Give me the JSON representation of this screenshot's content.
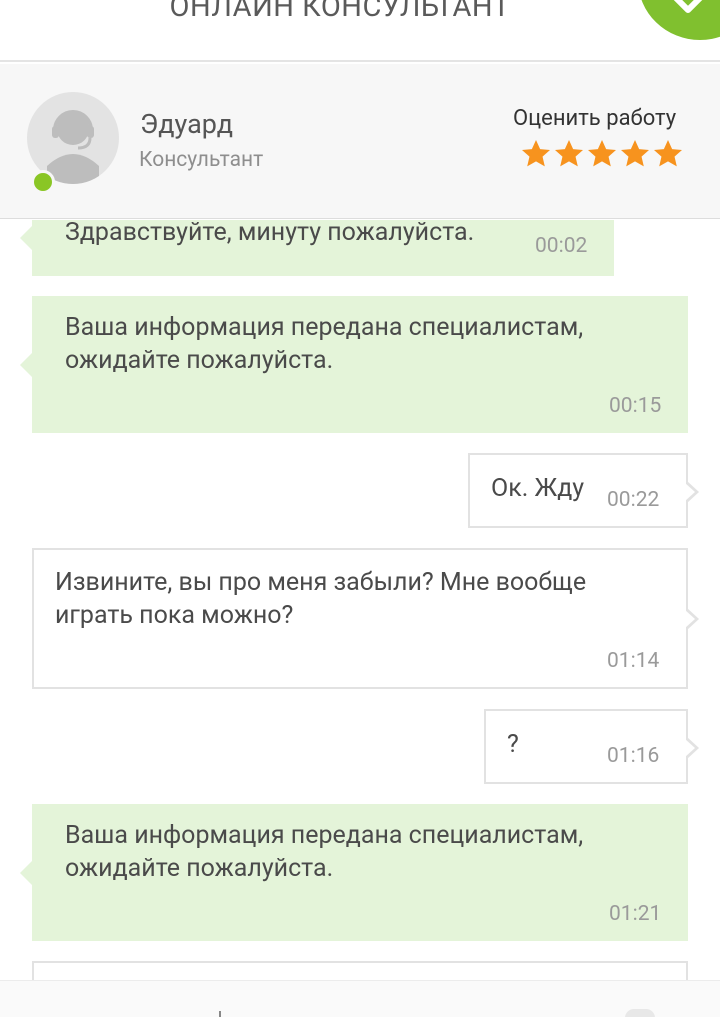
{
  "header": {
    "title": "ОНЛАЙН КОНСУЛЬТАНТ",
    "badge_icon": "check-icon",
    "accent": "#80c02f"
  },
  "consultant": {
    "name": "Эдуард",
    "role": "Консультант",
    "status": "online",
    "avatar_icon": "support-agent-icon",
    "rate_label": "Оценить работу",
    "rating": 5,
    "rating_max": 5,
    "star_color": "#f7931e"
  },
  "messages": [
    {
      "from": "operator",
      "text": "Здравствуйте, минуту пожалуйста.",
      "time": "00:02"
    },
    {
      "from": "operator",
      "text": "Ваша информация передана специалистам,\nожидайте пожалуйста.",
      "time": "00:15"
    },
    {
      "from": "user",
      "text": "Ок. Жду",
      "time": "00:22"
    },
    {
      "from": "user",
      "text": "Извините, вы про меня забыли? Мне вообще\nиграть пока можно?",
      "time": "01:14"
    },
    {
      "from": "user",
      "text": "?",
      "time": "01:16"
    },
    {
      "from": "operator",
      "text": "Ваша информация передана специалистам,\nожидайте пожалуйста.",
      "time": "01:21"
    }
  ]
}
